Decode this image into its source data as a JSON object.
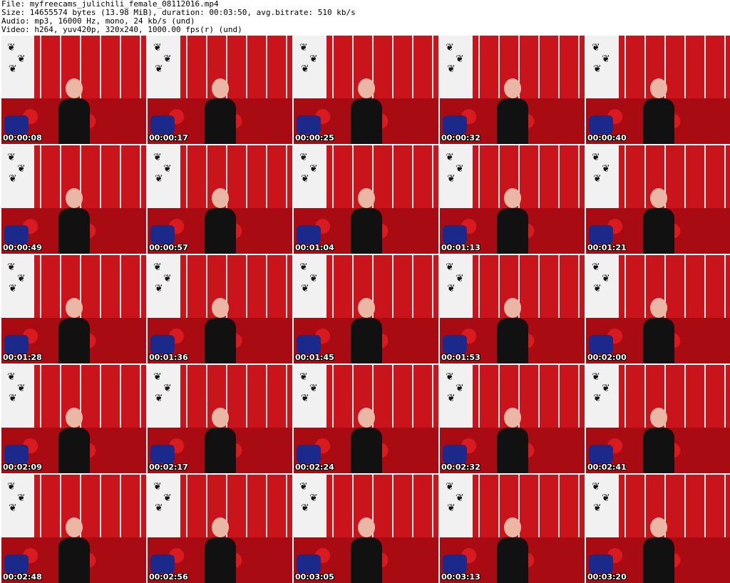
{
  "header": {
    "file_line": "File: myfreecams_julichili_female_08112016.mp4",
    "size_line": "Size: 14655574 bytes (13.98 MiB), duration: 00:03:50, avg.bitrate: 510 kb/s",
    "audio_line": "Audio: mp3, 16000 Hz, mono, 24 kb/s (und)",
    "video_line": "Video: h264, yuv420p, 320x240, 1000.00 fps(r) (und)"
  },
  "icons": {
    "butterfly": "butterfly-icon"
  },
  "thumbnails": [
    {
      "timestamp": "00:00:08"
    },
    {
      "timestamp": "00:00:17"
    },
    {
      "timestamp": "00:00:25"
    },
    {
      "timestamp": "00:00:32"
    },
    {
      "timestamp": "00:00:40"
    },
    {
      "timestamp": "00:00:49"
    },
    {
      "timestamp": "00:00:57"
    },
    {
      "timestamp": "00:01:04"
    },
    {
      "timestamp": "00:01:13"
    },
    {
      "timestamp": "00:01:21"
    },
    {
      "timestamp": "00:01:28"
    },
    {
      "timestamp": "00:01:36"
    },
    {
      "timestamp": "00:01:45"
    },
    {
      "timestamp": "00:01:53"
    },
    {
      "timestamp": "00:02:00"
    },
    {
      "timestamp": "00:02:09"
    },
    {
      "timestamp": "00:02:17"
    },
    {
      "timestamp": "00:02:24"
    },
    {
      "timestamp": "00:02:32"
    },
    {
      "timestamp": "00:02:41"
    },
    {
      "timestamp": "00:02:48"
    },
    {
      "timestamp": "00:02:56"
    },
    {
      "timestamp": "00:03:05"
    },
    {
      "timestamp": "00:03:13"
    },
    {
      "timestamp": "00:03:20"
    }
  ]
}
